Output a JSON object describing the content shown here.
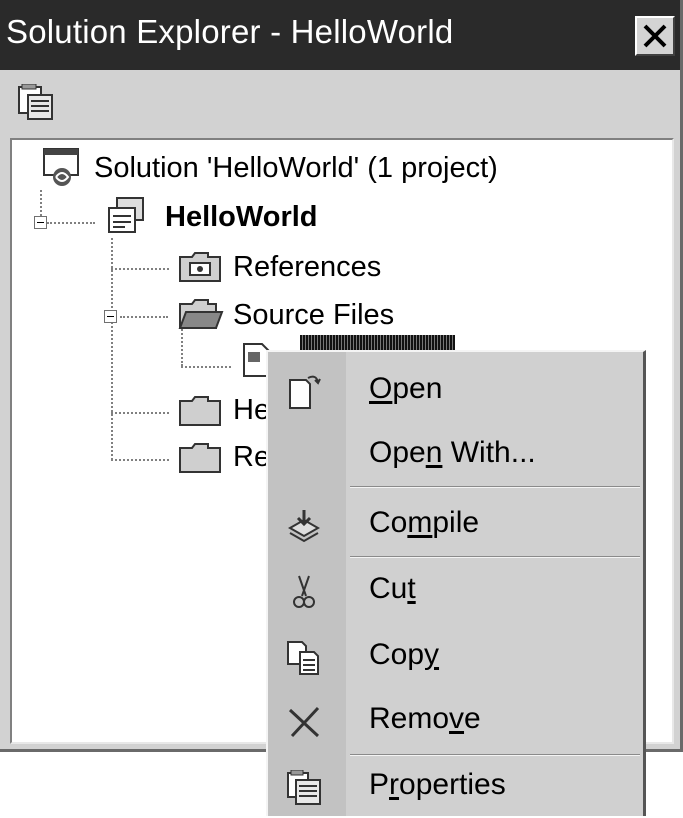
{
  "window": {
    "title": "Solution Explorer - HelloWorld",
    "close_icon": "close-x-icon"
  },
  "toolbar": {
    "properties_icon": "properties-icon"
  },
  "tree": {
    "solution_label": "Solution 'HelloWorld' (1 project)",
    "project_label": "HelloWorld",
    "references_label": "References",
    "source_files_label": "Source Files",
    "header_files_label": "He",
    "resource_files_label": "Re"
  },
  "context_menu": {
    "items": [
      {
        "pre": "",
        "ul": "O",
        "post": "pen",
        "icon": "open-document-icon"
      },
      {
        "pre": "Ope",
        "ul": "n",
        "post": " With...",
        "icon": ""
      },
      {
        "pre": "Co",
        "ul": "m",
        "post": "pile",
        "icon": "compile-icon"
      },
      {
        "pre": "Cu",
        "ul": "t",
        "post": "",
        "icon": "scissors-icon"
      },
      {
        "pre": "Cop",
        "ul": "y",
        "post": "",
        "icon": "copy-icon"
      },
      {
        "pre": "Remo",
        "ul": "v",
        "post": "e",
        "icon": "remove-x-icon"
      },
      {
        "pre": "P",
        "ul": "r",
        "post": "operties",
        "icon": "properties-icon"
      }
    ]
  },
  "colors": {
    "titlebar_bg": "#2a2a2a",
    "panel_bg": "#d2d2d2",
    "tree_bg": "#ffffff",
    "menu_bg": "#d0d0d0",
    "menu_gutter": "#c2c2c2"
  }
}
